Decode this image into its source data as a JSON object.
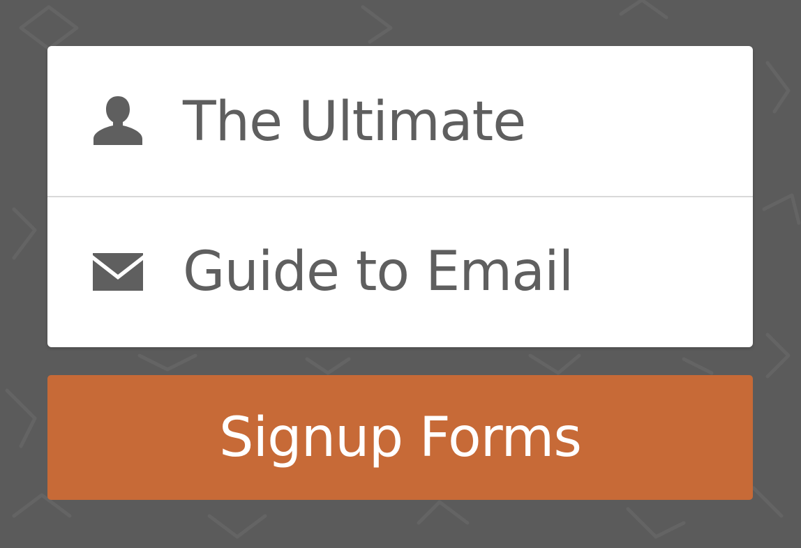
{
  "form": {
    "name_field": {
      "icon": "user-icon",
      "value": "The Ultimate"
    },
    "email_field": {
      "icon": "envelope-icon",
      "value": "Guide to Email"
    },
    "submit_label": "Signup Forms"
  },
  "colors": {
    "background": "#5b5b5b",
    "card": "#ffffff",
    "field_text": "#5f5f5f",
    "divider": "#d9d9d9",
    "button": "#c76a37",
    "button_text": "#ffffff"
  }
}
